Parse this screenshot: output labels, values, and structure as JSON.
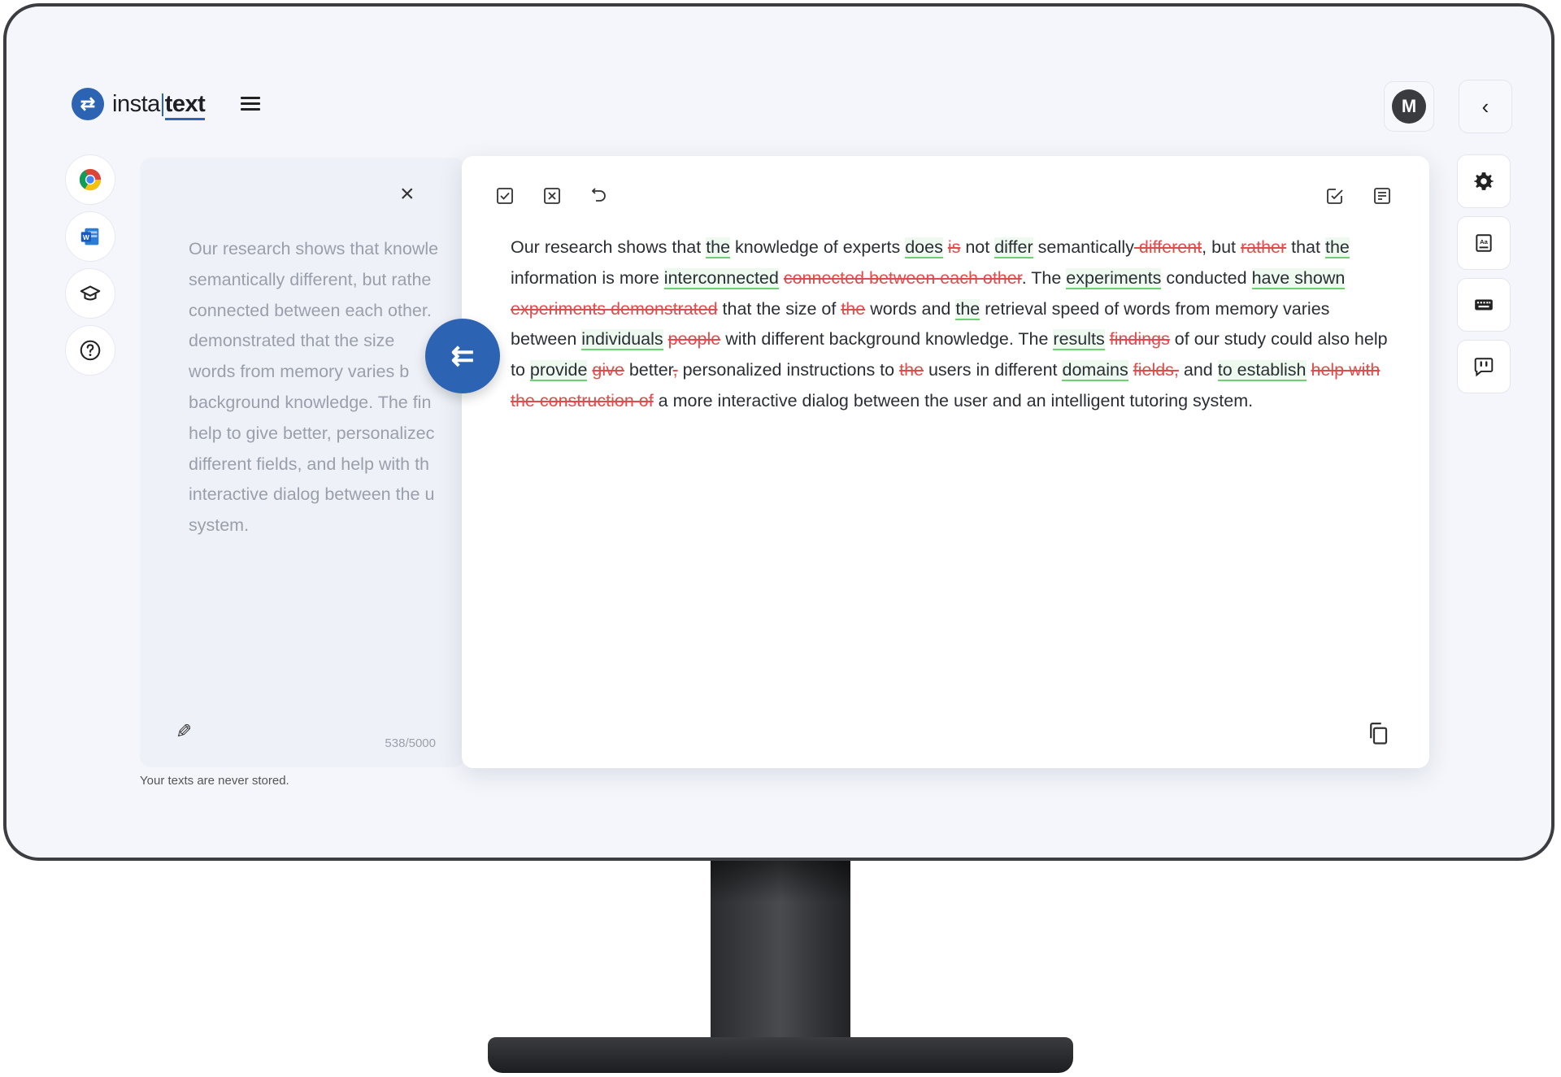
{
  "app": {
    "logo_mark": "⇄",
    "logo_part1": "insta",
    "logo_part2": "text"
  },
  "header": {
    "avatar_initial": "M",
    "collapse_icon": "chevron-left-icon"
  },
  "left_rail": [
    {
      "name": "chrome-extension",
      "icon": "chrome-icon"
    },
    {
      "name": "word-addin",
      "icon": "word-icon"
    },
    {
      "name": "academy",
      "icon": "graduation-cap-icon"
    },
    {
      "name": "help",
      "icon": "help-circle-icon"
    }
  ],
  "source": {
    "text": "Our research shows that knowle\nsemantically different, but rathe\nconnected between each other.\ndemonstrated that the size\nwords from memory varies b\nbackground knowledge. The fin\nhelp to give better, personalizec\ndifferent fields, and help with th\ninteractive dialog between the u\nsystem.",
    "char_count": "538/5000",
    "privacy_note": "Your texts are never stored."
  },
  "result": {
    "segments": [
      {
        "t": "Our research shows that "
      },
      {
        "t": "the",
        "k": "ins"
      },
      {
        "t": " knowledge of experts "
      },
      {
        "t": "does",
        "k": "ins"
      },
      {
        "t": " "
      },
      {
        "t": "is",
        "k": "del"
      },
      {
        "t": " not "
      },
      {
        "t": "differ",
        "k": "ins"
      },
      {
        "t": " semantically"
      },
      {
        "t": " different",
        "k": "del"
      },
      {
        "t": ", but "
      },
      {
        "t": "rather",
        "k": "del"
      },
      {
        "t": " that "
      },
      {
        "t": "the",
        "k": "ins"
      },
      {
        "t": " information is more "
      },
      {
        "t": "interconnected",
        "k": "ins"
      },
      {
        "t": " "
      },
      {
        "t": "connected between each other",
        "k": "del"
      },
      {
        "t": ". The "
      },
      {
        "t": "experiments",
        "k": "ins"
      },
      {
        "t": " conducted "
      },
      {
        "t": "have shown",
        "k": "ins"
      },
      {
        "t": " "
      },
      {
        "t": "experiments demonstrated",
        "k": "del"
      },
      {
        "t": " that the size of "
      },
      {
        "t": "the",
        "k": "del"
      },
      {
        "t": " words and "
      },
      {
        "t": "the",
        "k": "ins"
      },
      {
        "t": " retrieval speed of words from memory varies between "
      },
      {
        "t": "individuals",
        "k": "ins"
      },
      {
        "t": " "
      },
      {
        "t": "people",
        "k": "del"
      },
      {
        "t": " with different background knowledge. The "
      },
      {
        "t": "results",
        "k": "ins"
      },
      {
        "t": " "
      },
      {
        "t": "findings",
        "k": "del"
      },
      {
        "t": " of our study could also help to "
      },
      {
        "t": "provide",
        "k": "ins"
      },
      {
        "t": " "
      },
      {
        "t": "give",
        "k": "del"
      },
      {
        "t": " better"
      },
      {
        "t": ",",
        "k": "del"
      },
      {
        "t": " personalized instructions to "
      },
      {
        "t": "the",
        "k": "del"
      },
      {
        "t": " users in different "
      },
      {
        "t": "domains",
        "k": "ins"
      },
      {
        "t": " "
      },
      {
        "t": "fields,",
        "k": "del"
      },
      {
        "t": " and "
      },
      {
        "t": "to establish",
        "k": "ins"
      },
      {
        "t": " "
      },
      {
        "t": "help with the construction of",
        "k": "del"
      },
      {
        "t": " a more interactive dialog between the user and an intelligent tutoring system."
      }
    ],
    "toolbar_left": [
      "accept-all-icon",
      "reject-all-icon",
      "undo-icon"
    ],
    "toolbar_right": [
      "apply-changes-icon",
      "summary-icon"
    ],
    "colors": {
      "insert": "#6fcf73",
      "delete": "#e24b4b"
    }
  },
  "right_rail": [
    {
      "name": "settings",
      "icon": "gear-icon"
    },
    {
      "name": "dictionary",
      "icon": "book-icon"
    },
    {
      "name": "keyboard-shortcuts",
      "icon": "keyboard-icon"
    },
    {
      "name": "feedback",
      "icon": "feedback-icon"
    }
  ]
}
